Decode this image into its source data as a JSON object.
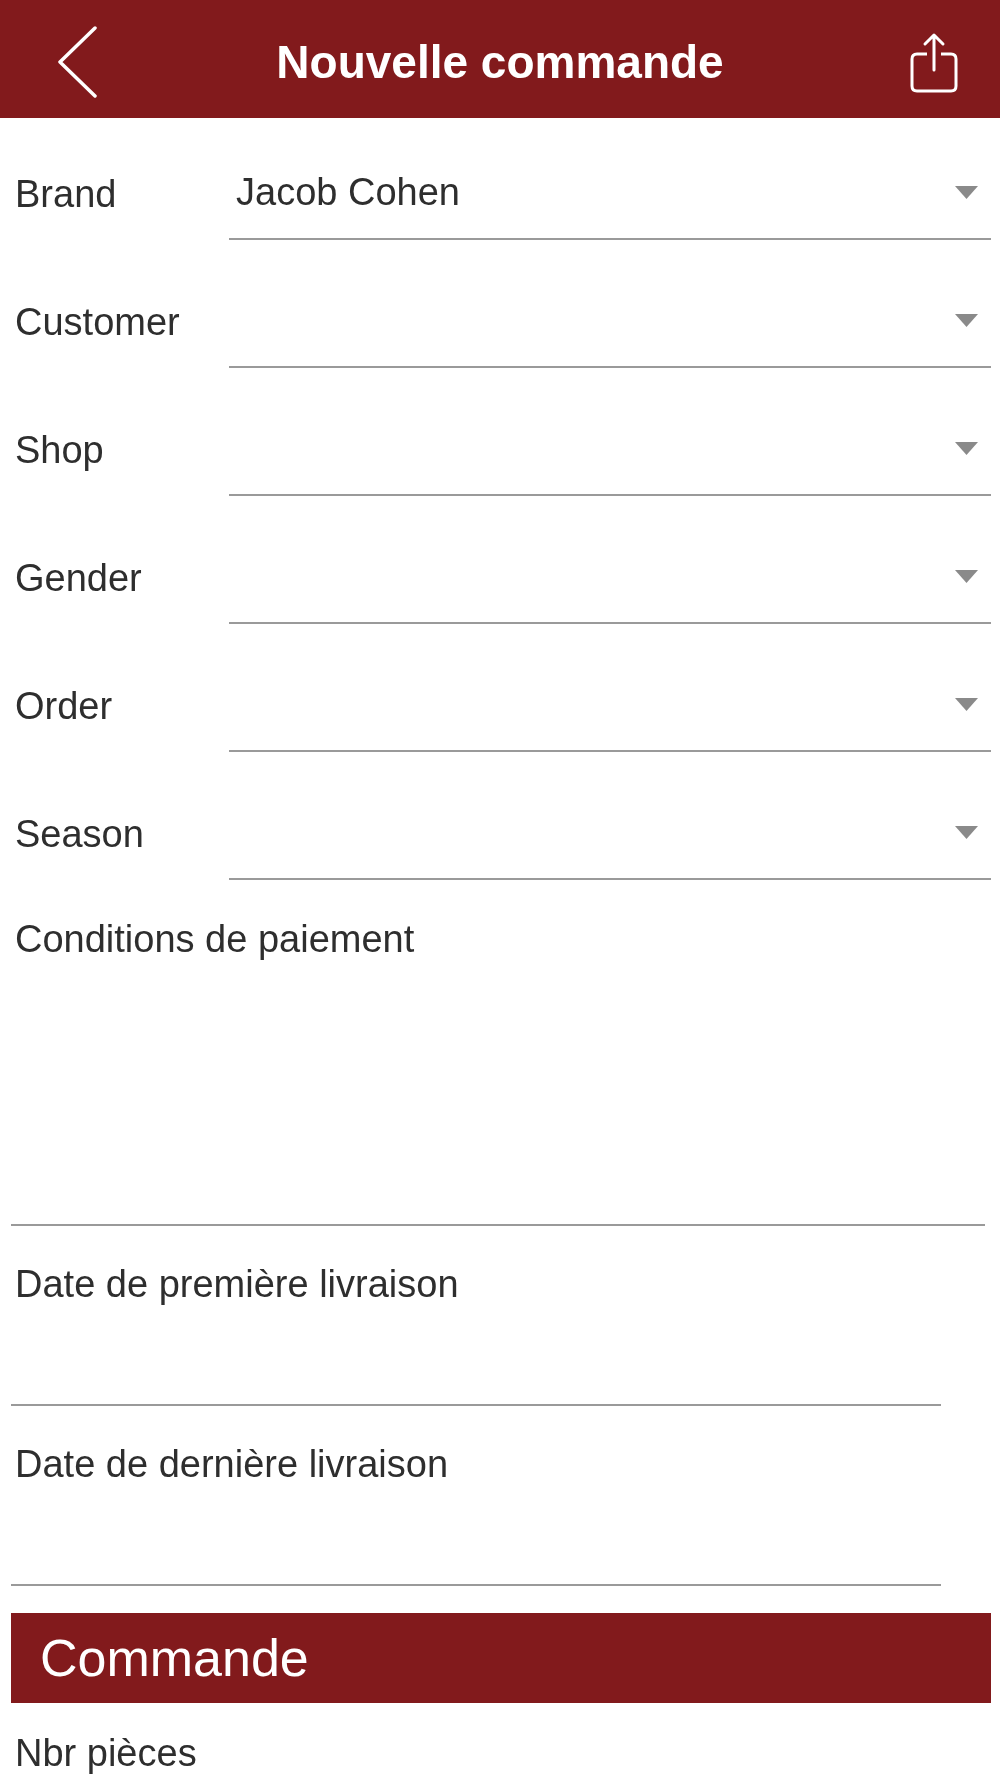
{
  "header": {
    "title": "Nouvelle commande"
  },
  "dropdowns": [
    {
      "label": "Brand",
      "value": "Jacob Cohen"
    },
    {
      "label": "Customer"
    },
    {
      "label": "Shop"
    },
    {
      "label": "Gender"
    },
    {
      "label": "Order"
    },
    {
      "label": "Season"
    }
  ],
  "payment_terms": {
    "label": "Conditions de paiement"
  },
  "dates": [
    {
      "label": "Date de première livraison"
    },
    {
      "label": "Date de dernière livraison"
    }
  ],
  "section": {
    "title": "Commande"
  },
  "next_field": {
    "label": "Nbr pièces"
  }
}
